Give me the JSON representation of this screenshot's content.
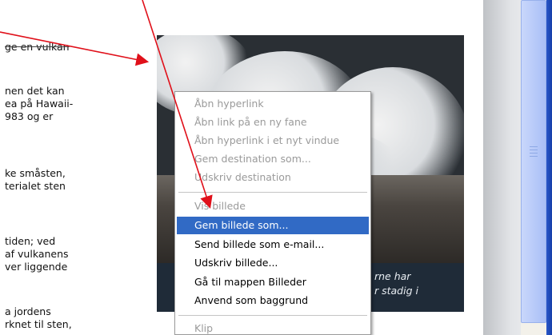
{
  "article_fragments": [
    {
      "text": "ge en vulkan",
      "strike": true
    },
    {
      "text": "nen det kan",
      "strike": false
    },
    {
      "text": "ea på Hawaii-",
      "strike": false
    },
    {
      "text": "983 og er",
      "strike": false
    },
    {
      "text": "ke småsten,",
      "strike": false
    },
    {
      "text": "terialet sten",
      "strike": false
    },
    {
      "text": "tiden; ved",
      "strike": false
    },
    {
      "text": "af vulkanens",
      "strike": false
    },
    {
      "text": "ver liggende",
      "strike": false
    },
    {
      "text": "a jordens",
      "strike": false
    },
    {
      "text": "rknet til sten,",
      "strike": false
    }
  ],
  "photo_caption": {
    "line1": "rne har",
    "line2": "r stadig i"
  },
  "context_menu": {
    "items": [
      {
        "label": "Åbn hyperlink",
        "state": "disabled"
      },
      {
        "label": "Åbn link på en ny fane",
        "state": "disabled"
      },
      {
        "label": "Åbn hyperlink i et nyt vindue",
        "state": "disabled"
      },
      {
        "label": "Gem destination som...",
        "state": "disabled"
      },
      {
        "label": "Udskriv destination",
        "state": "disabled"
      },
      {
        "label": "Vis billede",
        "state": "disabled"
      },
      {
        "label": "Gem billede som...",
        "state": "selected"
      },
      {
        "label": "Send billede som e-mail...",
        "state": "enabled"
      },
      {
        "label": "Udskriv billede...",
        "state": "enabled"
      },
      {
        "label": "Gå til mappen Billeder",
        "state": "enabled"
      },
      {
        "label": "Anvend som baggrund",
        "state": "enabled"
      },
      {
        "label": "Klip",
        "state": "disabled"
      }
    ]
  },
  "colors": {
    "selection": "#316ac5",
    "annotation_arrow": "#e0101a",
    "caption_band": "#1f2b38"
  }
}
